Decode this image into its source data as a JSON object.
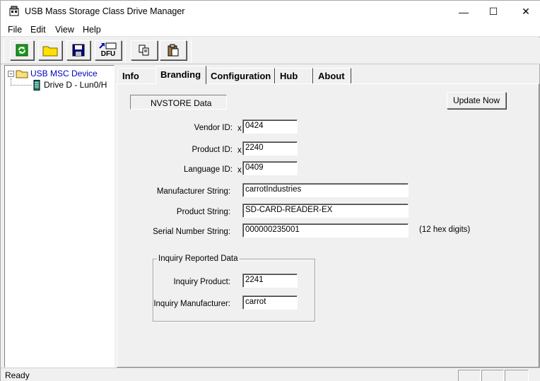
{
  "window": {
    "title": "USB Mass Storage Class Drive Manager",
    "minimize_glyph": "—",
    "maximize_glyph": "☐",
    "close_glyph": "✕"
  },
  "menu": {
    "items": [
      "File",
      "Edit",
      "View",
      "Help"
    ]
  },
  "toolbar": {
    "buttons": [
      {
        "name": "refresh-icon"
      },
      {
        "name": "open-folder-icon"
      },
      {
        "name": "save-icon"
      },
      {
        "name": "dfu-icon",
        "label": "DFU"
      },
      {
        "name": "copy-icon"
      },
      {
        "name": "paste-icon"
      }
    ]
  },
  "tree": {
    "expander": "−",
    "root_label": "USB MSC Device",
    "child_label": "Drive D - Lun0/H"
  },
  "tabs": {
    "items": [
      "Info",
      "Branding",
      "Configuration",
      "Hub",
      "About"
    ],
    "active": "Branding"
  },
  "branding": {
    "nvstore_label": "NVSTORE Data",
    "update_button": "Update Now",
    "hex_prefix": "x",
    "vendor_id_label": "Vendor ID:",
    "vendor_id_value": "0424",
    "product_id_label": "Product ID:",
    "product_id_value": "2240",
    "language_id_label": "Language  ID:",
    "language_id_value": "0409",
    "manufacturer_string_label": "Manufacturer String:",
    "manufacturer_string_value": "carrotIndustries",
    "product_string_label": "Product String:",
    "product_string_value": "SD-CARD-READER-EX",
    "serial_number_label": "Serial Number String:",
    "serial_number_value": "000000235001",
    "serial_note": "(12 hex digits)",
    "inquiry_group_title": "Inquiry Reported Data",
    "inquiry_product_label": "Inquiry Product:",
    "inquiry_product_value": "2241",
    "inquiry_manufacturer_label": "Inquiry Manufacturer:",
    "inquiry_manufacturer_value": "carrot"
  },
  "status": {
    "text": "Ready"
  }
}
